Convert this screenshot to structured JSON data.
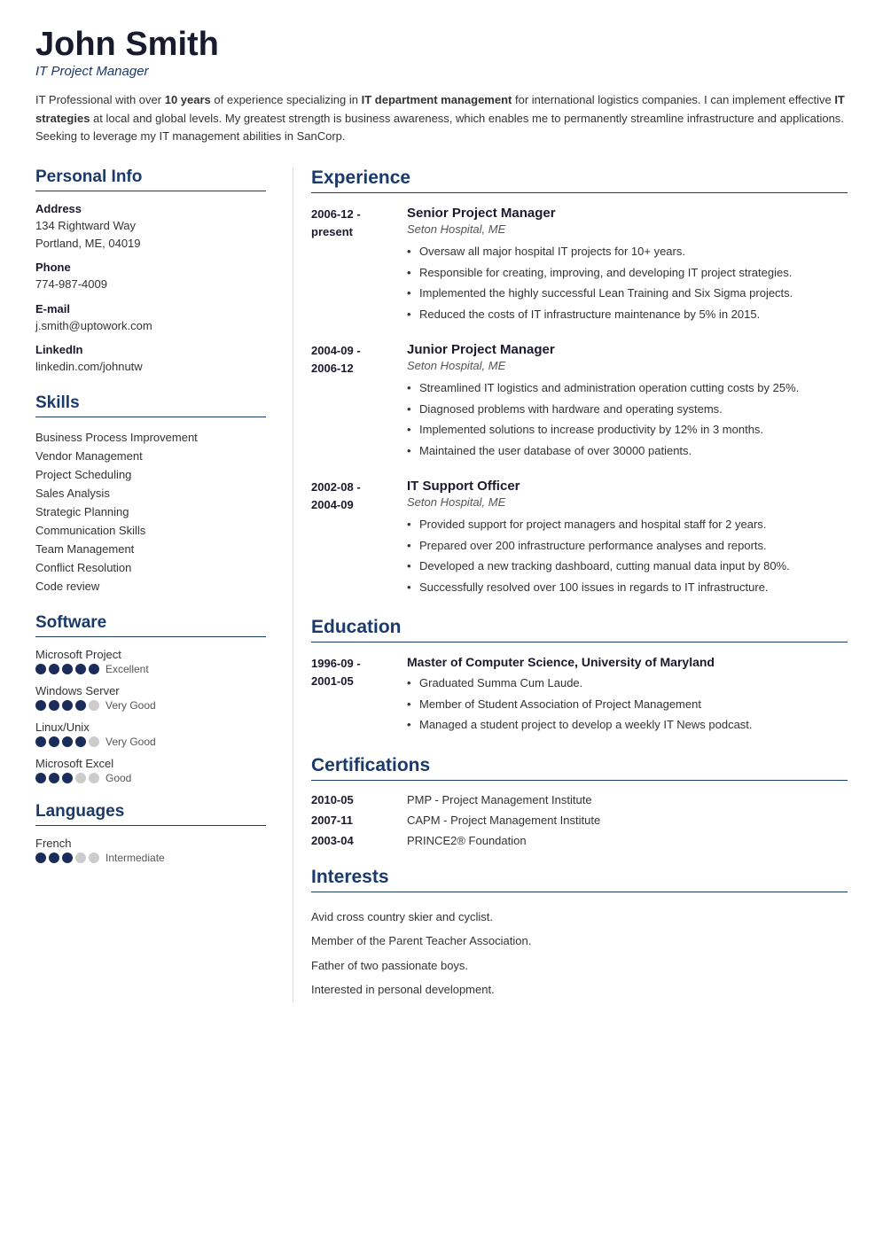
{
  "header": {
    "name": "John Smith",
    "title": "IT Project Manager",
    "summary": "IT Professional with over 10 years of experience specializing in IT department management for international logistics companies. I can implement effective IT strategies at local and global levels. My greatest strength is business awareness, which enables me to permanently streamline infrastructure and applications. Seeking to leverage my IT management abilities in SanCorp."
  },
  "personal_info": {
    "section_label": "Personal Info",
    "address_label": "Address",
    "address_line1": "134 Rightward Way",
    "address_line2": "Portland, ME, 04019",
    "phone_label": "Phone",
    "phone": "774-987-4009",
    "email_label": "E-mail",
    "email": "j.smith@uptowork.com",
    "linkedin_label": "LinkedIn",
    "linkedin": "linkedin.com/johnutw"
  },
  "skills": {
    "section_label": "Skills",
    "items": [
      "Business Process Improvement",
      "Vendor Management",
      "Project Scheduling",
      "Sales Analysis",
      "Strategic Planning",
      "Communication Skills",
      "Team Management",
      "Conflict Resolution",
      "Code review"
    ]
  },
  "software": {
    "section_label": "Software",
    "items": [
      {
        "name": "Microsoft Project",
        "filled": 5,
        "total": 5,
        "label": "Excellent"
      },
      {
        "name": "Windows Server",
        "filled": 4,
        "total": 5,
        "label": "Very Good"
      },
      {
        "name": "Linux/Unix",
        "filled": 4,
        "total": 5,
        "label": "Very Good"
      },
      {
        "name": "Microsoft Excel",
        "filled": 3,
        "total": 5,
        "label": "Good"
      }
    ]
  },
  "languages": {
    "section_label": "Languages",
    "items": [
      {
        "name": "French",
        "filled": 3,
        "total": 5,
        "label": "Intermediate"
      }
    ]
  },
  "experience": {
    "section_label": "Experience",
    "items": [
      {
        "date_start": "2006-12 -",
        "date_end": "present",
        "title": "Senior Project Manager",
        "company": "Seton Hospital, ME",
        "bullets": [
          "Oversaw all major hospital IT projects for 10+ years.",
          "Responsible for creating, improving, and developing IT project strategies.",
          "Implemented the highly successful Lean Training and Six Sigma projects.",
          "Reduced the costs of IT infrastructure maintenance by 5% in 2015."
        ]
      },
      {
        "date_start": "2004-09 -",
        "date_end": "2006-12",
        "title": "Junior Project Manager",
        "company": "Seton Hospital, ME",
        "bullets": [
          "Streamlined IT logistics and administration operation cutting costs by 25%.",
          "Diagnosed problems with hardware and operating systems.",
          "Implemented solutions to increase productivity by 12% in 3 months.",
          "Maintained the user database of over 30000 patients."
        ]
      },
      {
        "date_start": "2002-08 -",
        "date_end": "2004-09",
        "title": "IT Support Officer",
        "company": "Seton Hospital, ME",
        "bullets": [
          "Provided support for project managers and hospital staff for 2 years.",
          "Prepared over 200 infrastructure performance analyses and reports.",
          "Developed a new tracking dashboard, cutting manual data input by 80%.",
          "Successfully resolved over 100 issues in regards to IT infrastructure."
        ]
      }
    ]
  },
  "education": {
    "section_label": "Education",
    "items": [
      {
        "date_start": "1996-09 -",
        "date_end": "2001-05",
        "title": "Master of Computer Science, University of Maryland",
        "bullets": [
          "Graduated Summa Cum Laude.",
          "Member of Student Association of Project Management",
          "Managed a student project to develop a weekly IT News podcast."
        ]
      }
    ]
  },
  "certifications": {
    "section_label": "Certifications",
    "items": [
      {
        "date": "2010-05",
        "name": "PMP - Project Management Institute"
      },
      {
        "date": "2007-11",
        "name": "CAPM - Project Management Institute"
      },
      {
        "date": "2003-04",
        "name": "PRINCE2® Foundation"
      }
    ]
  },
  "interests": {
    "section_label": "Interests",
    "items": [
      "Avid cross country skier and cyclist.",
      "Member of the Parent Teacher Association.",
      "Father of two passionate boys.",
      "Interested in personal development."
    ]
  }
}
